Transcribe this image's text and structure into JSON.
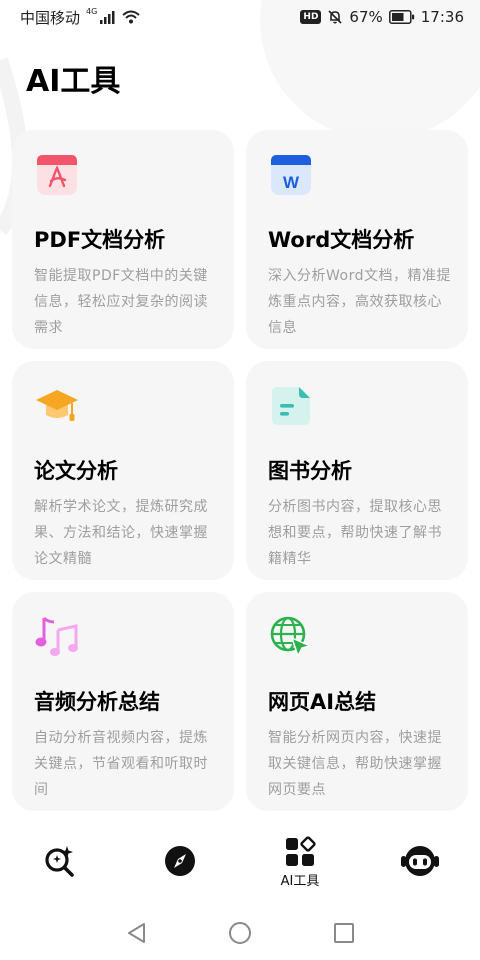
{
  "status_bar": {
    "carrier": "中国移动",
    "network": "4G",
    "hd": "HD",
    "battery": "67%",
    "time": "17:36"
  },
  "page": {
    "title": "AI工具"
  },
  "tools": [
    {
      "name": "PDF文档分析",
      "desc": "智能提取PDF文档中的关键信息，轻松应对复杂的阅读需求",
      "icon": "pdf-icon"
    },
    {
      "name": "Word文档分析",
      "desc": "深入分析Word文档，精准提炼重点内容，高效获取核心信息",
      "icon": "word-icon"
    },
    {
      "name": "论文分析",
      "desc": "解析学术论文，提炼研究成果、方法和结论，快速掌握论文精髓",
      "icon": "graduation-cap-icon"
    },
    {
      "name": "图书分析",
      "desc": "分析图书内容，提取核心思想和要点，帮助快速了解书籍精华",
      "icon": "book-document-icon"
    },
    {
      "name": "音频分析总结",
      "desc": "自动分析音视频内容，提炼关键点，节省观看和听取时间",
      "icon": "music-note-icon"
    },
    {
      "name": "网页AI总结",
      "desc": "智能分析网页内容，快速提取关键信息，帮助快速掌握网页要点",
      "icon": "globe-cursor-icon"
    }
  ],
  "icon_labels": {
    "pdf_glyph": "",
    "word_glyph": "W"
  },
  "bottom_nav": {
    "items": [
      {
        "label": "",
        "icon": "sparkle-search-icon"
      },
      {
        "label": "",
        "icon": "compass-icon"
      },
      {
        "label": "AI工具",
        "icon": "apps-grid-icon",
        "active": true
      },
      {
        "label": "",
        "icon": "robot-avatar-icon"
      }
    ]
  },
  "colors": {
    "card_bg": "#f6f6f6",
    "pdf": "#f2556b",
    "word": "#1e5fe0",
    "cap": "#f5a623",
    "book": "#3cbcb2",
    "music": "#e65ee0",
    "globe": "#2bb24c"
  }
}
